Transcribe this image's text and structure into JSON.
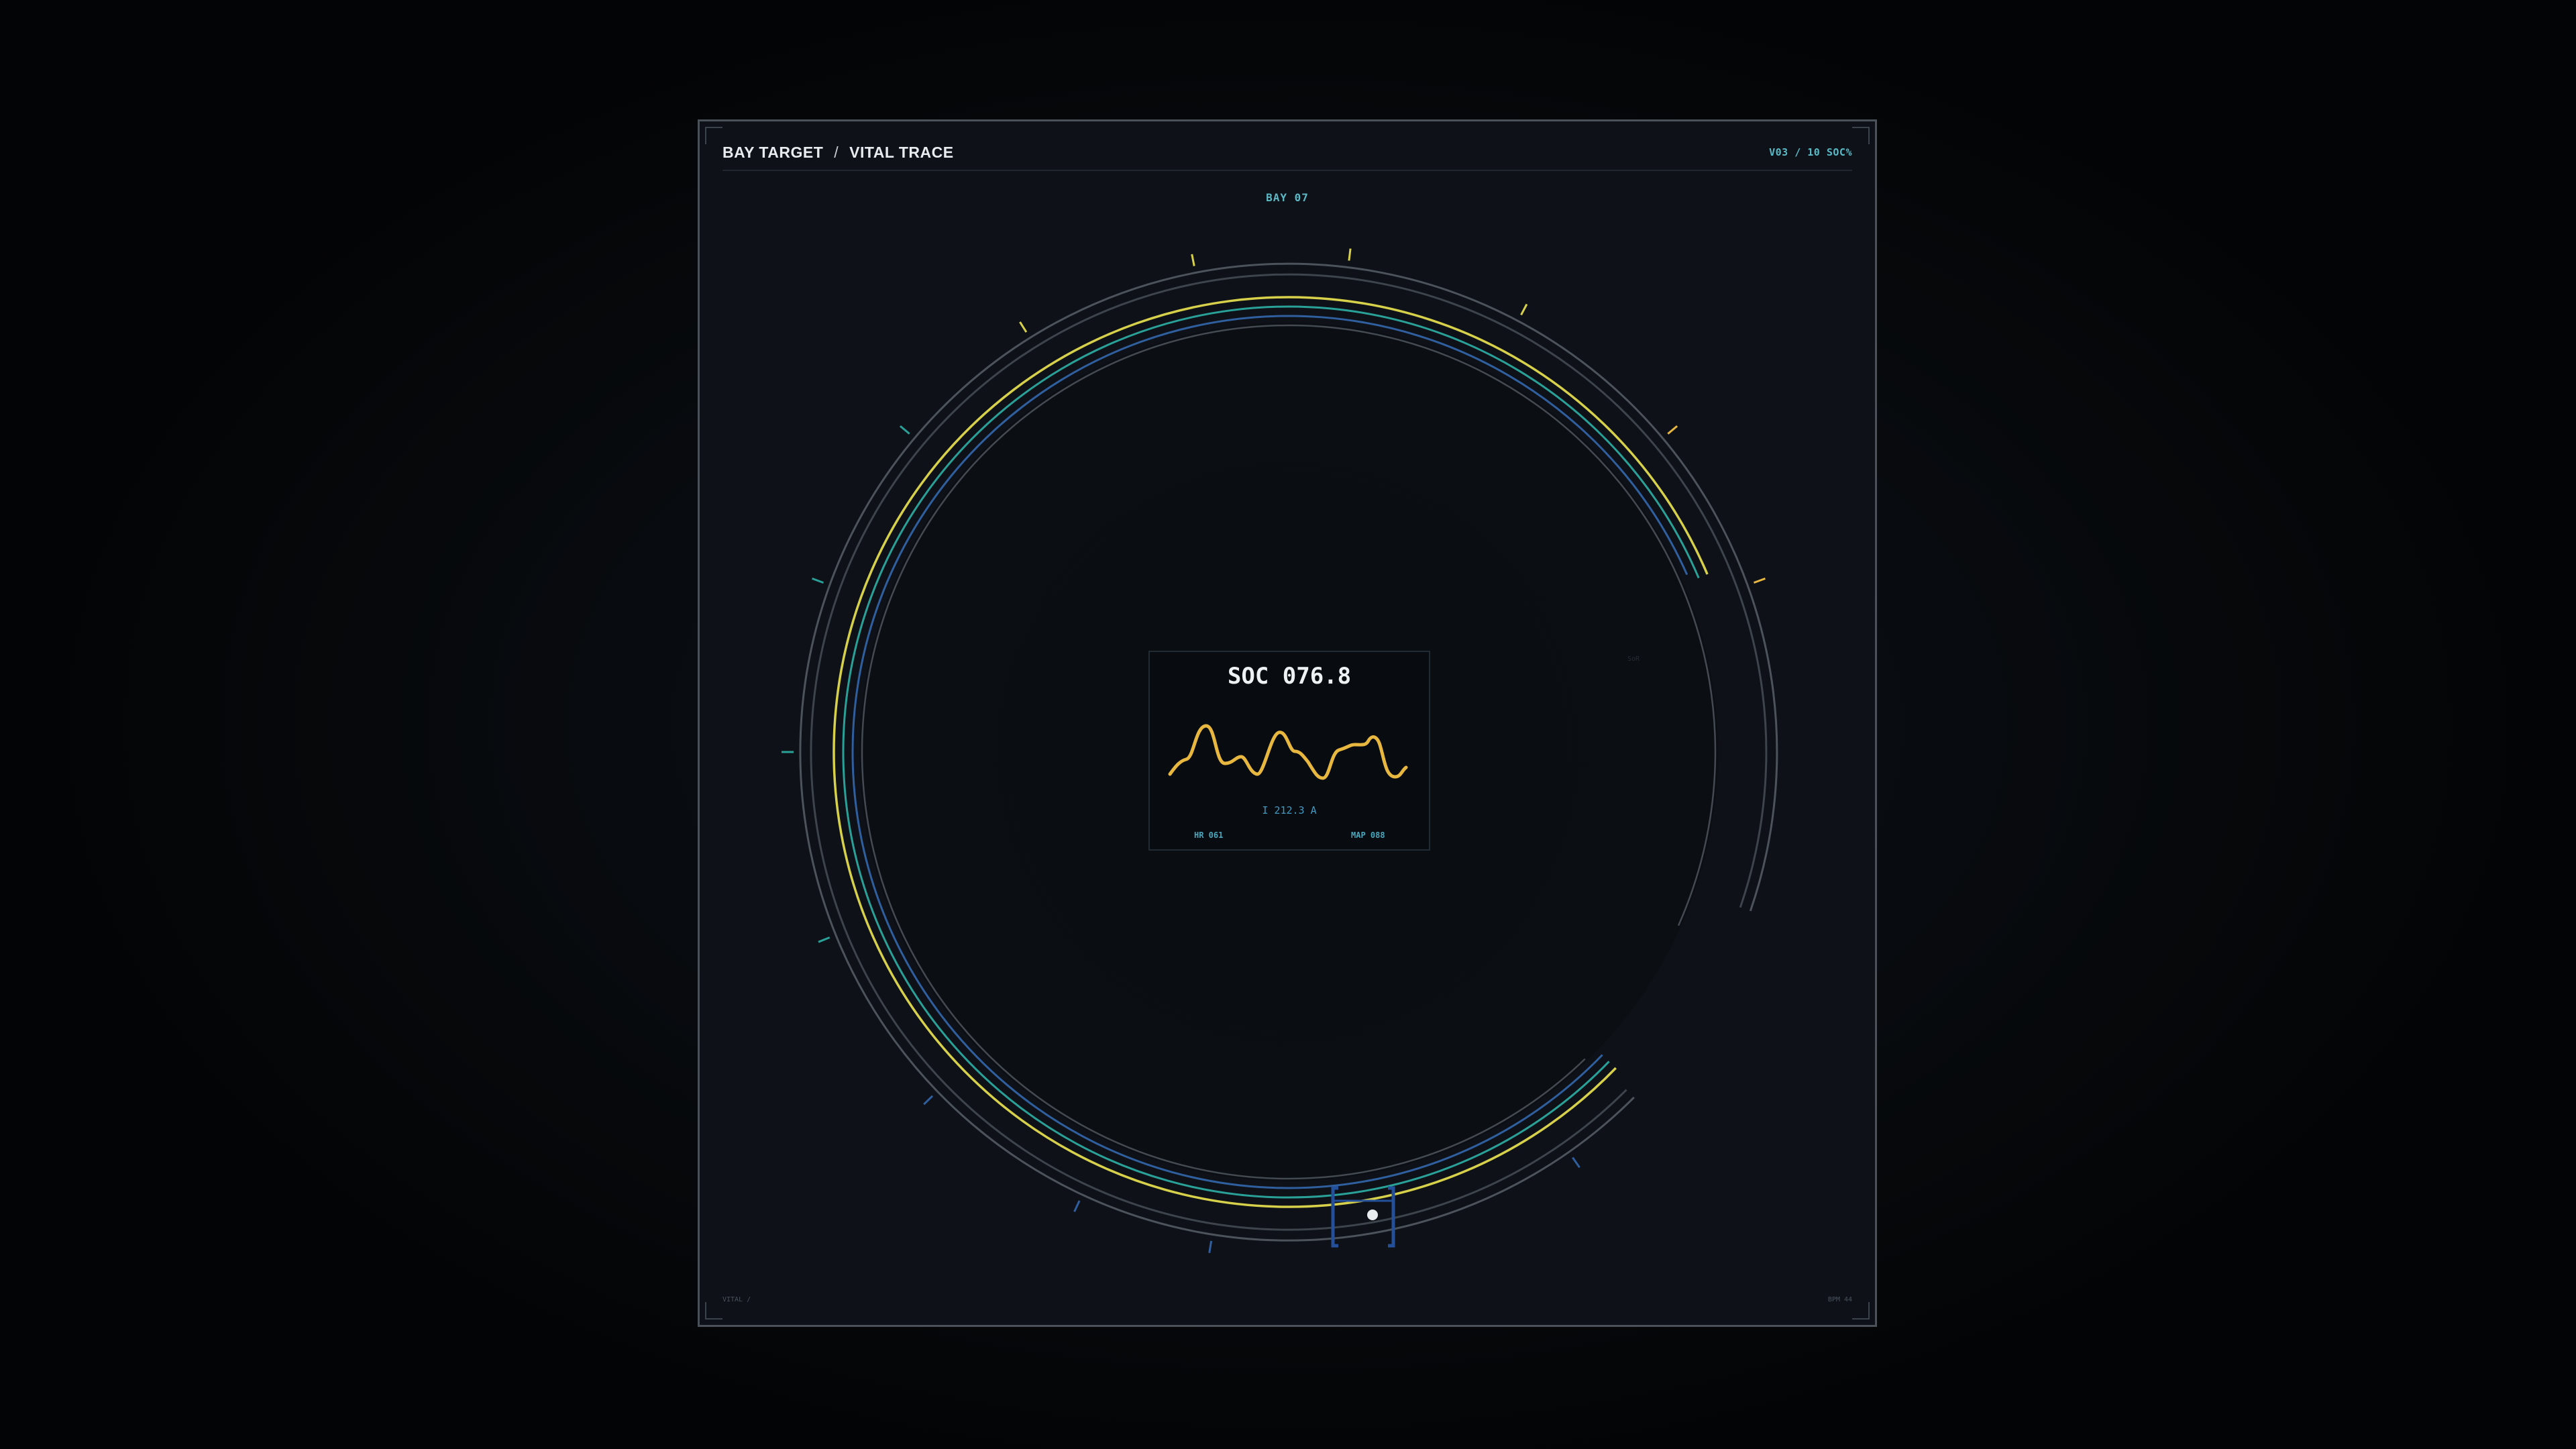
{
  "header": {
    "title_primary": "BAY TARGET",
    "title_separator": "/",
    "title_secondary": "VITAL TRACE",
    "meta": "V03 / 10  SOC%"
  },
  "dial": {
    "bay_label": "BAY 07",
    "faint_label": "SoR"
  },
  "readout": {
    "soc": "SOC 076.8",
    "current": "I 212.3 A",
    "hr": "HR 061",
    "map": "MAP 088"
  },
  "footer": {
    "left": "VITAL /",
    "right": "BPM 44"
  },
  "colors": {
    "accent_cyan": "#59b9c6",
    "trace_yellow": "#d7d04a",
    "trace_teal": "#2aa198",
    "trace_blue": "#2f5f9e",
    "wave_amber": "#e8b73f",
    "marker_blue": "#244f9a"
  }
}
